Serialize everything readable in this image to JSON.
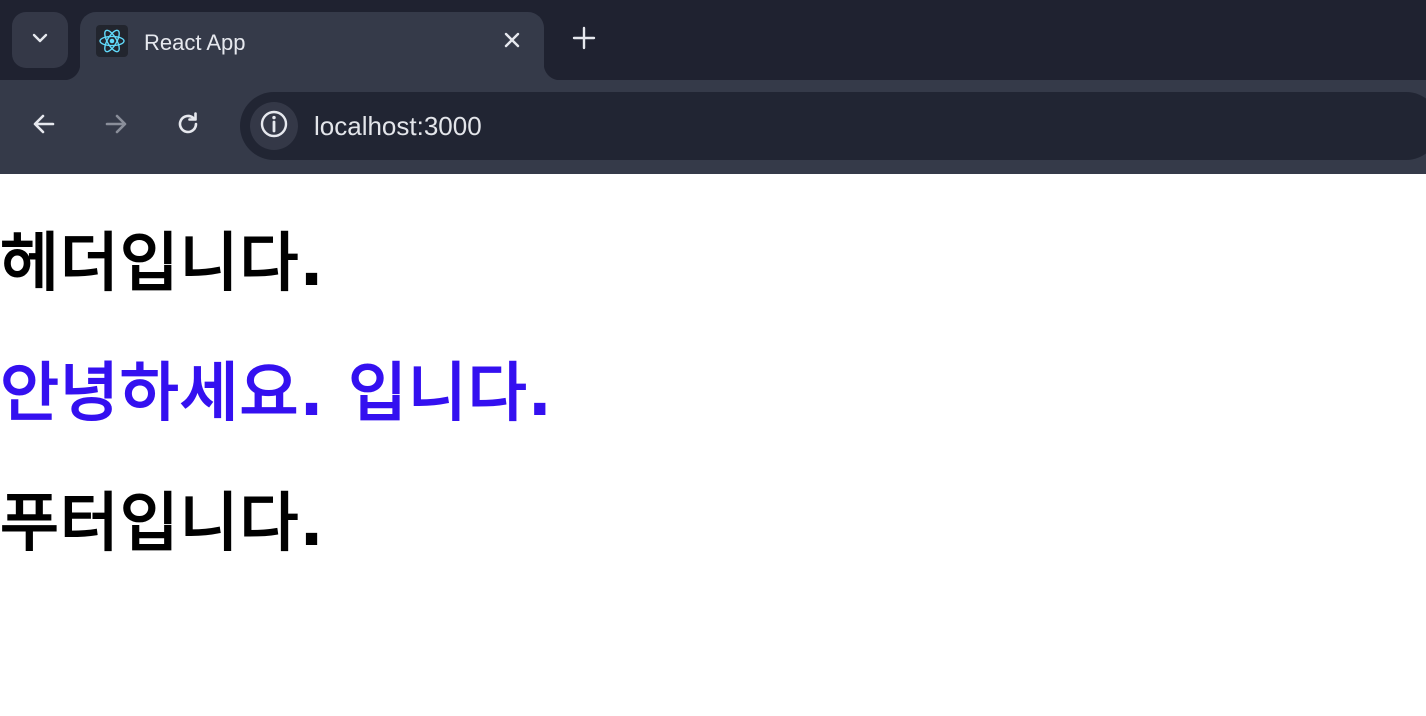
{
  "tab": {
    "title": "React App",
    "favicon": "react-logo-icon"
  },
  "toolbar": {
    "url": "localhost:3000"
  },
  "page": {
    "header_text": "헤더입니다.",
    "greeting_text": "안녕하세요. 입니다.",
    "footer_text": "푸터입니다."
  },
  "colors": {
    "greeting": "#3410f0",
    "chrome_dark": "#1f2230",
    "chrome_tab": "#353a49"
  }
}
